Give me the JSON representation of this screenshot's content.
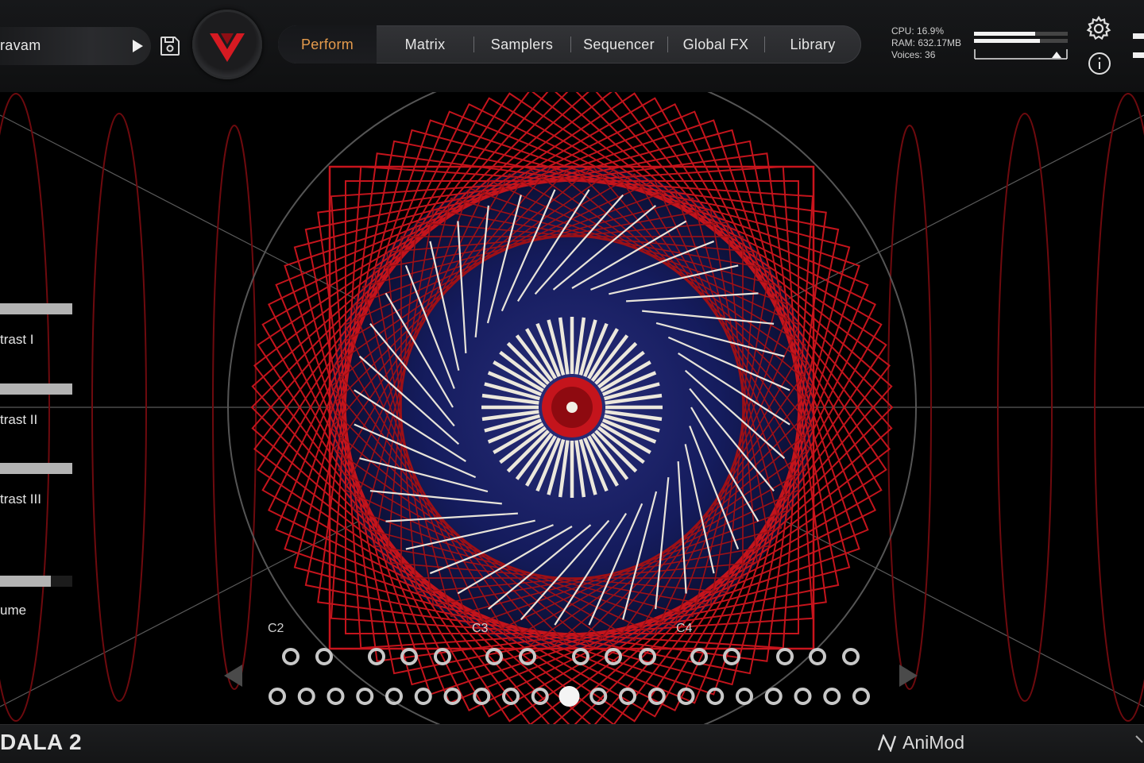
{
  "header": {
    "preset_name": "ravam",
    "tabs": [
      {
        "label": "Perform",
        "active": true
      },
      {
        "label": "Matrix"
      },
      {
        "label": "Samplers"
      },
      {
        "label": "Sequencer"
      },
      {
        "label": "Global FX"
      },
      {
        "label": "Library"
      }
    ],
    "stats": {
      "cpu": "CPU: 16.9%",
      "ram": "RAM: 632.17MB",
      "voices": "Voices: 36"
    },
    "meter": {
      "level_top": 0.65,
      "level_bottom": 0.7
    }
  },
  "sidebar": {
    "controls": [
      {
        "label": "trast I",
        "value": 1.0
      },
      {
        "label": "trast II",
        "value": 1.0
      },
      {
        "label": "trast III",
        "value": 1.0
      },
      {
        "label": "ume",
        "value": 0.7
      }
    ]
  },
  "keyboard": {
    "octave_labels": [
      "C2",
      "C3",
      "C4"
    ],
    "active_key_index": 10
  },
  "footer": {
    "brand": "DALA 2",
    "maker": "AniMod"
  },
  "colors": {
    "accent": "#e59b4c",
    "red": "#c4141c",
    "deep_blue": "#121a5c"
  }
}
